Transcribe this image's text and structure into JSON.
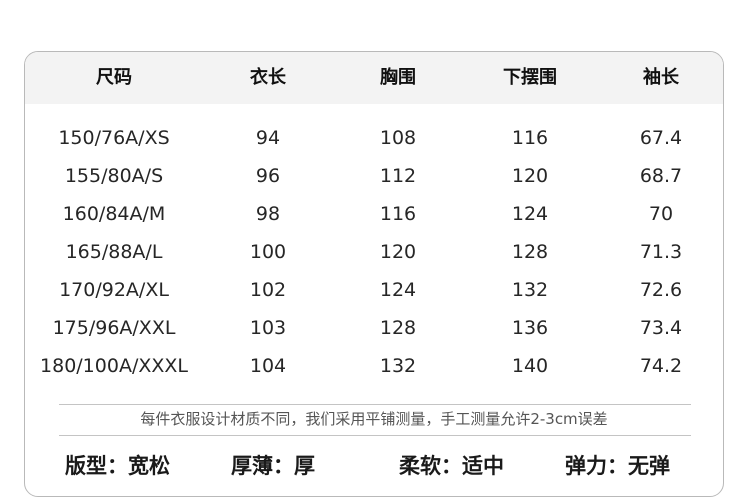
{
  "table": {
    "headers": [
      "尺码",
      "衣长",
      "胸围",
      "下摆围",
      "袖长"
    ],
    "rows": [
      [
        "150/76A/XS",
        "94",
        "108",
        "116",
        "67.4"
      ],
      [
        "155/80A/S",
        "96",
        "112",
        "120",
        "68.7"
      ],
      [
        "160/84A/M",
        "98",
        "116",
        "124",
        "70"
      ],
      [
        "165/88A/L",
        "100",
        "120",
        "128",
        "71.3"
      ],
      [
        "170/92A/XL",
        "102",
        "124",
        "132",
        "72.6"
      ],
      [
        "175/96A/XXL",
        "103",
        "128",
        "136",
        "73.4"
      ],
      [
        "180/100A/XXXL",
        "104",
        "132",
        "140",
        "74.2"
      ]
    ]
  },
  "note": "每件衣服设计材质不同，我们采用平铺测量，手工测量允许2-3cm误差",
  "attributes": [
    {
      "label": "版型：",
      "value": "宽松"
    },
    {
      "label": "厚薄：",
      "value": "厚"
    },
    {
      "label": "柔软：",
      "value": "适中"
    },
    {
      "label": "弹力：",
      "value": "无弹"
    }
  ]
}
